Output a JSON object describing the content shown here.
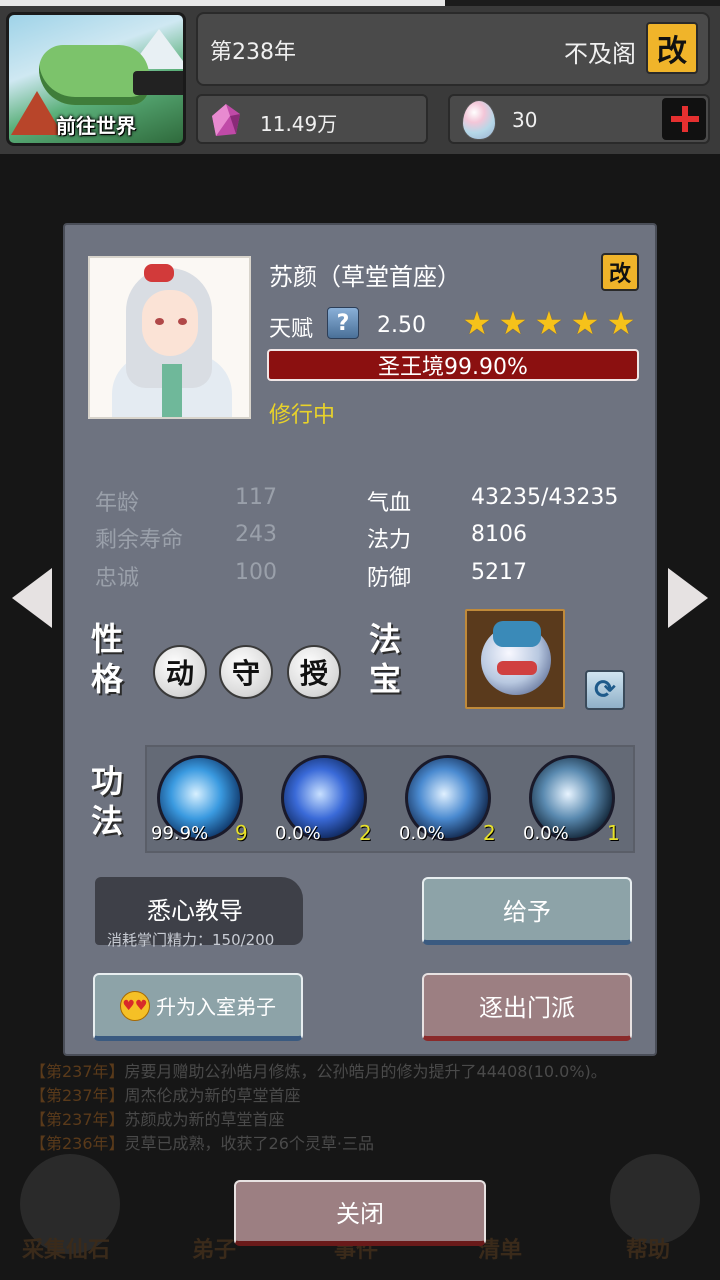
{
  "header": {
    "world_button": "前往世界",
    "year": "第238年",
    "sect_name": "不及阁",
    "rename_label": "改",
    "spirit_stones": "11.49万",
    "eggs": "30"
  },
  "disciple": {
    "name": "苏颜（草堂首座）",
    "rename_label": "改",
    "talent_label": "天赋",
    "talent_help": "?",
    "talent_value": "2.50",
    "stars": 5,
    "realm": "圣王境99.90%",
    "status": "修行中",
    "stats_left": [
      {
        "label": "年龄",
        "value": "117"
      },
      {
        "label": "剩余寿命",
        "value": "243"
      },
      {
        "label": "忠诚",
        "value": "100"
      }
    ],
    "stats_right": [
      {
        "label": "气血",
        "value": "43235/43235"
      },
      {
        "label": "法力",
        "value": "8106"
      },
      {
        "label": "防御",
        "value": "5217"
      }
    ],
    "personality_label_1": "性",
    "personality_label_2": "格",
    "traits": [
      "动",
      "守",
      "授"
    ],
    "treasure_label_1": "法",
    "treasure_label_2": "宝",
    "skills_label_1": "功",
    "skills_label_2": "法",
    "skills": [
      {
        "pct": "99.9%",
        "level": "9"
      },
      {
        "pct": "0.0%",
        "level": "2"
      },
      {
        "pct": "0.0%",
        "level": "2"
      },
      {
        "pct": "0.0%",
        "level": "1"
      }
    ]
  },
  "actions": {
    "teach": "悉心教导",
    "teach_cost": "消耗掌门精力：150/200",
    "give": "给予",
    "promote": "升为入室弟子",
    "expel": "逐出门派",
    "close": "关闭"
  },
  "background_log": [
    {
      "year": "【第237年】",
      "text": "房要月赠助公孙皓月修炼，公孙皓月的修为提升了44408(10.0%)。"
    },
    {
      "year": "【第237年】",
      "text": "周杰伦成为新的草堂首座"
    },
    {
      "year": "【第237年】",
      "text": "苏颜成为新的草堂首座"
    },
    {
      "year": "【第236年】",
      "text": "灵草已成熟，收获了26个灵草·三品"
    }
  ],
  "background_nav": [
    "采集仙石",
    "弟子",
    "事件",
    "清单",
    "帮助"
  ],
  "colors": {
    "panel": "#6e7380",
    "realm_bar": "#8b1010",
    "status": "#e8d22a",
    "accent_gold": "#f0b42a"
  }
}
